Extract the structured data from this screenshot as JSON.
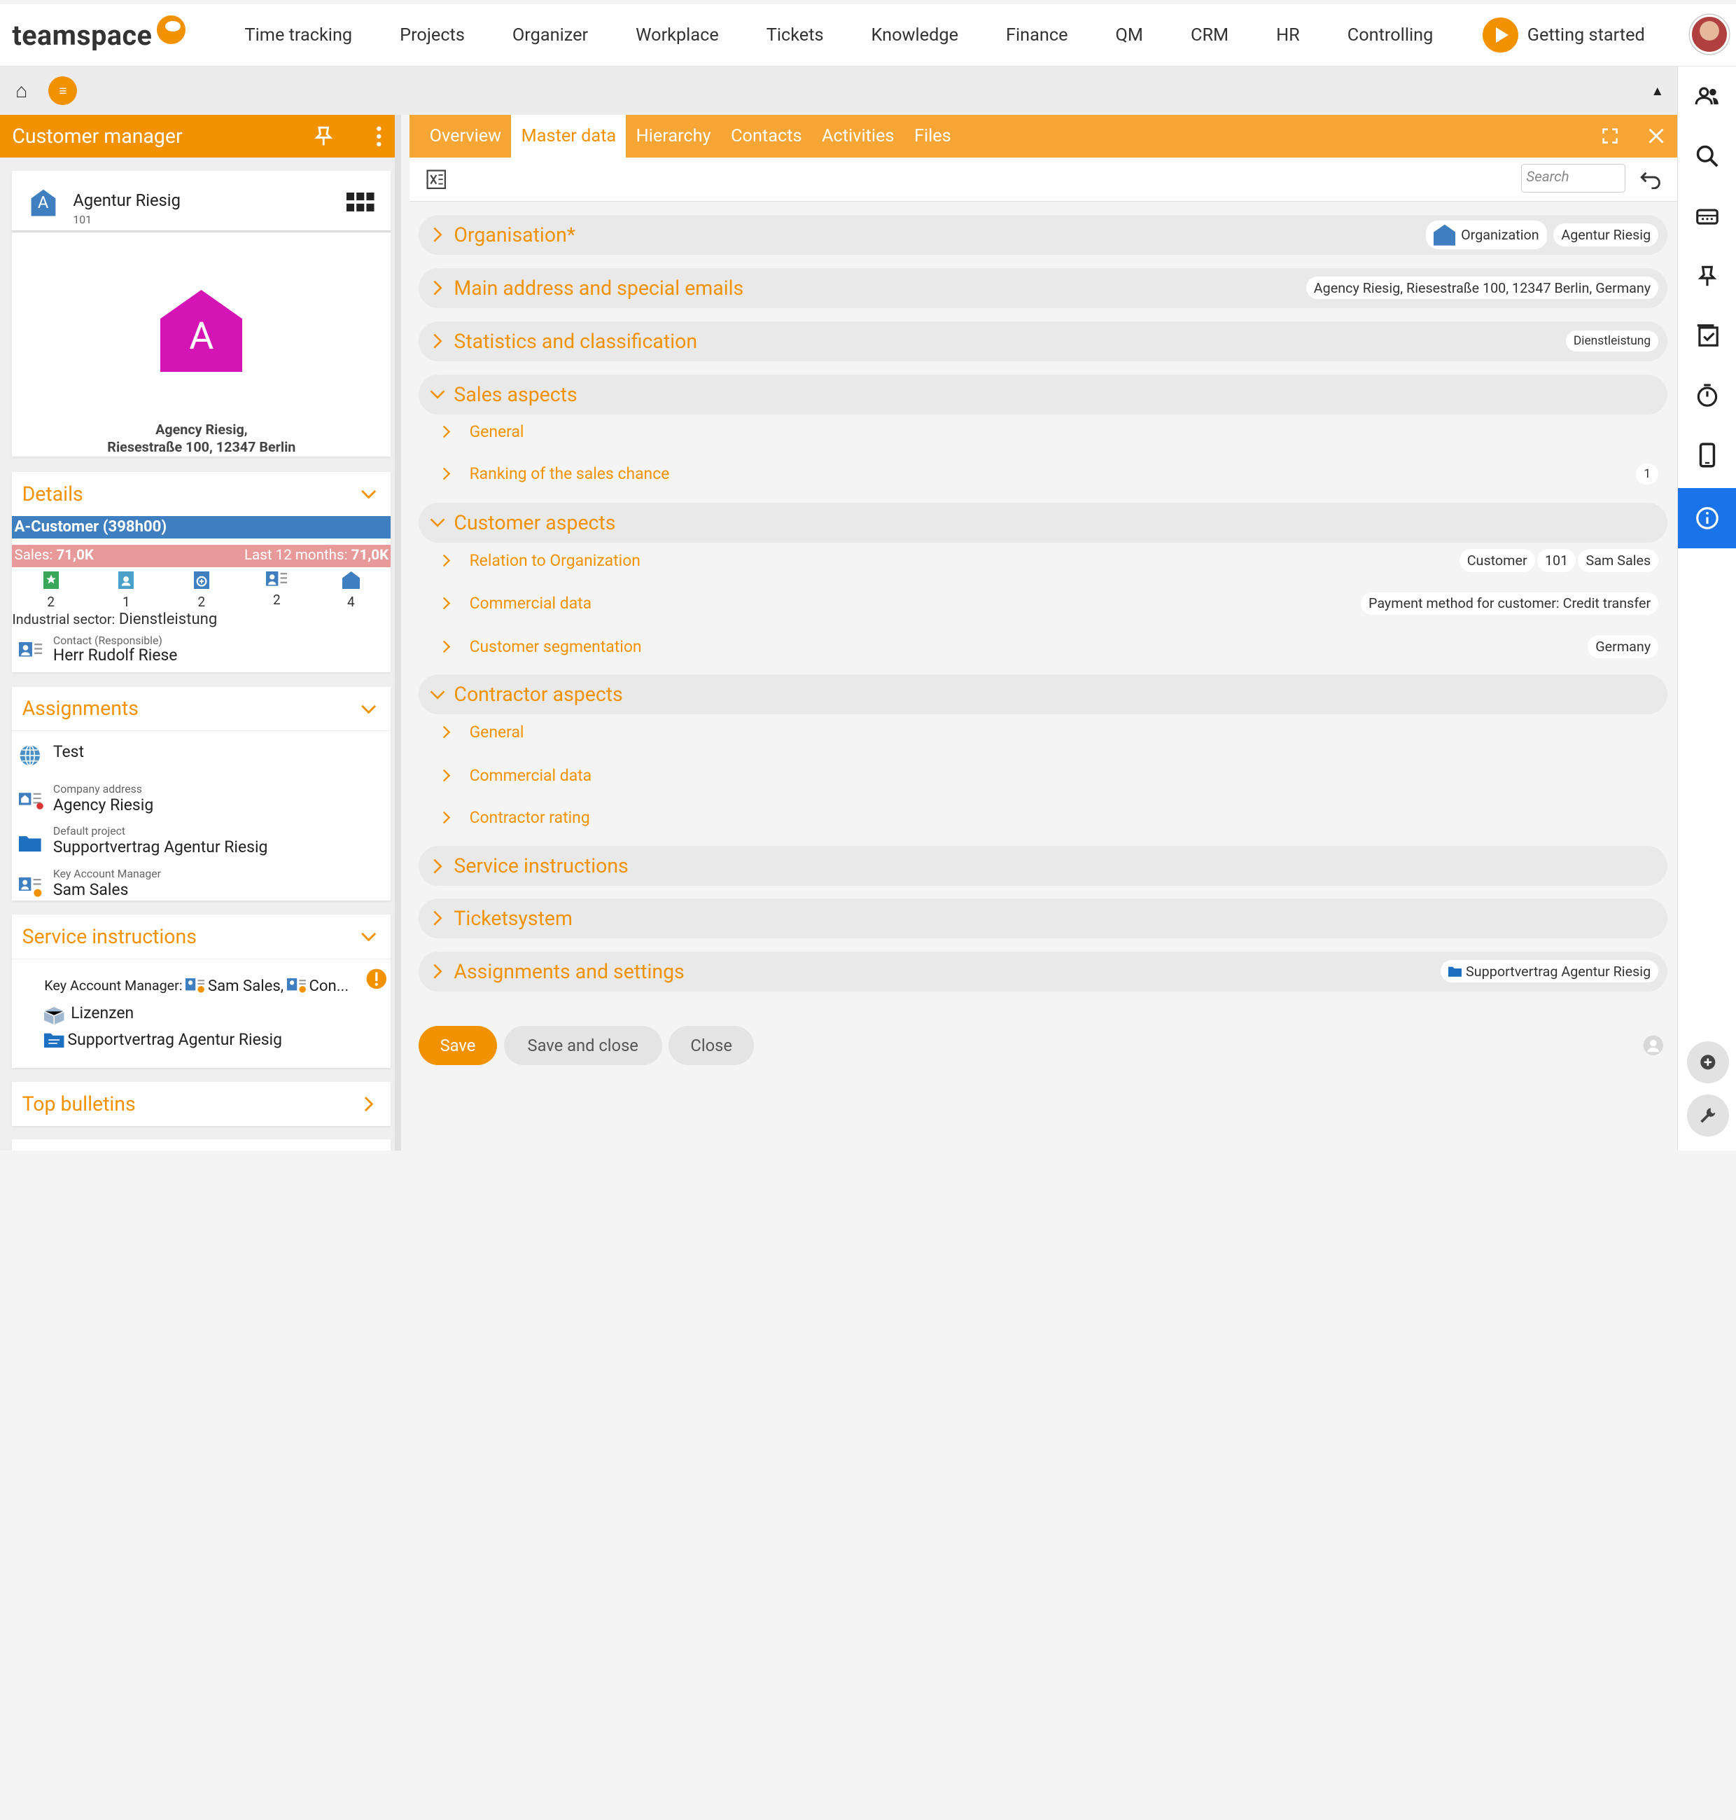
{
  "app": {
    "logo_text": "teamspace",
    "nav": [
      "Time tracking",
      "Projects",
      "Organizer",
      "Workplace",
      "Tickets",
      "Knowledge",
      "Finance",
      "QM",
      "CRM",
      "HR",
      "Controlling"
    ],
    "getting_started": "Getting started"
  },
  "colors": {
    "accent": "#f39200",
    "tab_bar": "#f7a535",
    "info_blue": "#1a73e8",
    "pink": "#d414b4",
    "bar_blue": "#3f7fbf",
    "bar_red": "#e89a9a"
  },
  "subbar": {
    "home_icon": "home-icon",
    "menu_icon": "menu-icon",
    "collapse_icon": "caret-up-icon"
  },
  "left": {
    "title": "Customer manager",
    "org": {
      "letter": "A",
      "name": "Agentur Riesig",
      "number": "101",
      "big_letter": "A",
      "address_line1": "Agency Riesig,",
      "address_line2": "Riesestraße 100, 12347 Berlin"
    },
    "details": {
      "title": "Details",
      "class_bar": "A-Customer (398h00)",
      "sales_label": "Sales:",
      "sales_value": "71,0K",
      "last12_label": "Last 12 months:",
      "last12_value": "71,0K",
      "counts": [
        "2",
        "1",
        "2",
        "2",
        "4"
      ],
      "sector_label": "Industrial sector:",
      "sector_value": "Dienstleistung",
      "contact_label": "Contact (Responsible)",
      "contact_value": "Herr Rudolf Riese"
    },
    "assignments": {
      "title": "Assignments",
      "items": [
        {
          "label": "",
          "value": "Test"
        },
        {
          "label": "Company address",
          "value": "Agency Riesig"
        },
        {
          "label": "Default project",
          "value": "Supportvertrag Agentur Riesig"
        },
        {
          "label": "Key Account Manager",
          "value": "Sam Sales"
        }
      ]
    },
    "service": {
      "title": "Service instructions",
      "kam_label": "Key Account Manager:",
      "kam_value1": "Sam Sales,",
      "kam_value2": "Con...",
      "item2": "Lizenzen",
      "item3": "Supportvertrag Agentur Riesig"
    },
    "bulletins": {
      "title": "Top bulletins"
    }
  },
  "main": {
    "tabs": [
      "Overview",
      "Master data",
      "Hierarchy",
      "Contacts",
      "Activities",
      "Files"
    ],
    "search_placeholder": "Search",
    "sections": {
      "organisation": {
        "title": "Organisation*",
        "chip1": "Organization",
        "chip2": "Agentur Riesig"
      },
      "address": {
        "title": "Main address and special emails",
        "chip": "Agency Riesig, Riesestraße 100, 12347 Berlin, Germany"
      },
      "stats": {
        "title": "Statistics and classification",
        "chip": "Dienstleistung"
      },
      "sales": {
        "title": "Sales aspects",
        "general": "General",
        "ranking": "Ranking of the sales chance",
        "ranking_value": "1"
      },
      "customer": {
        "title": "Customer aspects",
        "relation": "Relation to Organization",
        "rel_v1": "Customer",
        "rel_v2": "101",
        "rel_v3": "Sam Sales",
        "commercial": "Commercial data",
        "commercial_value": "Payment method for customer: Credit transfer",
        "segmentation": "Customer segmentation",
        "segmentation_value": "Germany"
      },
      "contractor": {
        "title": "Contractor aspects",
        "general": "General",
        "commercial": "Commercial data",
        "rating": "Contractor rating"
      },
      "service": {
        "title": "Service instructions"
      },
      "ticket": {
        "title": "Ticketsystem"
      },
      "assign": {
        "title": "Assignments and settings",
        "chip": "Supportvertrag Agentur Riesig"
      }
    },
    "buttons": {
      "save": "Save",
      "save_close": "Save and close",
      "close": "Close"
    }
  }
}
